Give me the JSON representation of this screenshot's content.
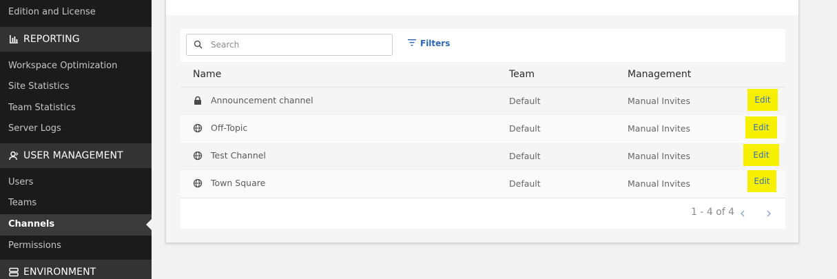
{
  "sidebar": {
    "edition_link": "Edition and License",
    "reporting": {
      "title": "REPORTING",
      "items": [
        "Workspace Optimization",
        "Site Statistics",
        "Team Statistics",
        "Server Logs"
      ]
    },
    "user_management": {
      "title": "USER MANAGEMENT",
      "items": [
        "Users",
        "Teams",
        "Channels",
        "Permissions"
      ],
      "active": "Channels"
    },
    "environment": {
      "title": "ENVIRONMENT"
    }
  },
  "toolbar": {
    "search_placeholder": "Search",
    "filters_label": "Filters"
  },
  "table": {
    "headers": {
      "name": "Name",
      "team": "Team",
      "management": "Management"
    },
    "rows": [
      {
        "name": "Announcement channel",
        "icon": "lock-icon",
        "team": "Default",
        "management": "Manual Invites",
        "action": "Edit"
      },
      {
        "name": "Off-Topic",
        "icon": "globe-icon",
        "team": "Default",
        "management": "Manual Invites",
        "action": "Edit"
      },
      {
        "name": "Test Channel",
        "icon": "globe-icon",
        "team": "Default",
        "management": "Manual Invites",
        "action": "Edit"
      },
      {
        "name": "Town Square",
        "icon": "globe-icon",
        "team": "Default",
        "management": "Manual Invites",
        "action": "Edit"
      }
    ]
  },
  "pagination": {
    "text": "1 - 4 of 4"
  },
  "colors": {
    "sidebar_bg": "#1b1b1b",
    "section_bg": "#333333",
    "highlight": "#f7f000",
    "link": "#2d66b8"
  }
}
